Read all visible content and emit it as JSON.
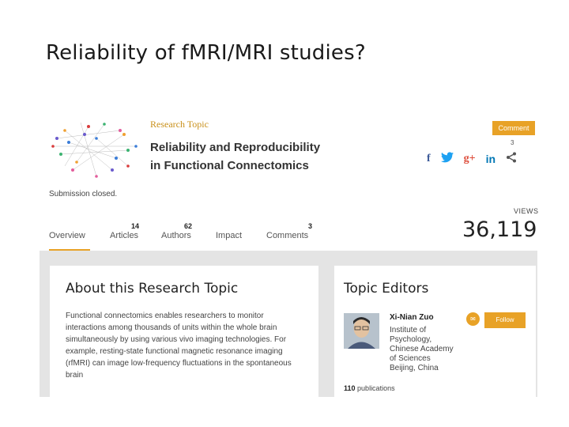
{
  "slide": {
    "title": "Reliability of fMRI/MRI studies?"
  },
  "topic": {
    "label": "Research Topic",
    "title_line1": "Reliability and Reproducibility",
    "title_line2": "in Functional Connectomics",
    "submission_status": "Submission closed."
  },
  "actions": {
    "comment_label": "Comment",
    "comment_count": "3",
    "share": {
      "facebook": "f",
      "twitter": "🐦",
      "google": "g+",
      "linkedin": "in",
      "share": "⋖"
    }
  },
  "stats": {
    "views_label": "VIEWS",
    "views_value": "36,119"
  },
  "tabs": [
    {
      "label": "Overview",
      "count": ""
    },
    {
      "label": "Articles",
      "count": "14"
    },
    {
      "label": "Authors",
      "count": "62"
    },
    {
      "label": "Impact",
      "count": ""
    },
    {
      "label": "Comments",
      "count": "3"
    }
  ],
  "about": {
    "title": "About this Research Topic",
    "text": "Functional connectomics enables researchers to monitor interactions among thousands of units within the whole brain simultaneously by using various vivo imaging technologies. For example, resting-state functional magnetic resonance imaging (rfMRI) can image low-frequency fluctuations in the spontaneous brain"
  },
  "editors": {
    "title": "Topic Editors",
    "name": "Xi-Nian Zuo",
    "affiliation": [
      "Institute of",
      "Psychology,",
      "Chinese Academy",
      "of Sciences",
      "Beijing, China"
    ],
    "follow_label": "Follow",
    "publications_count": "110",
    "publications_label": "publications"
  },
  "colors": {
    "accent": "#e8a227",
    "panel_bg": "#e4e4e4"
  }
}
